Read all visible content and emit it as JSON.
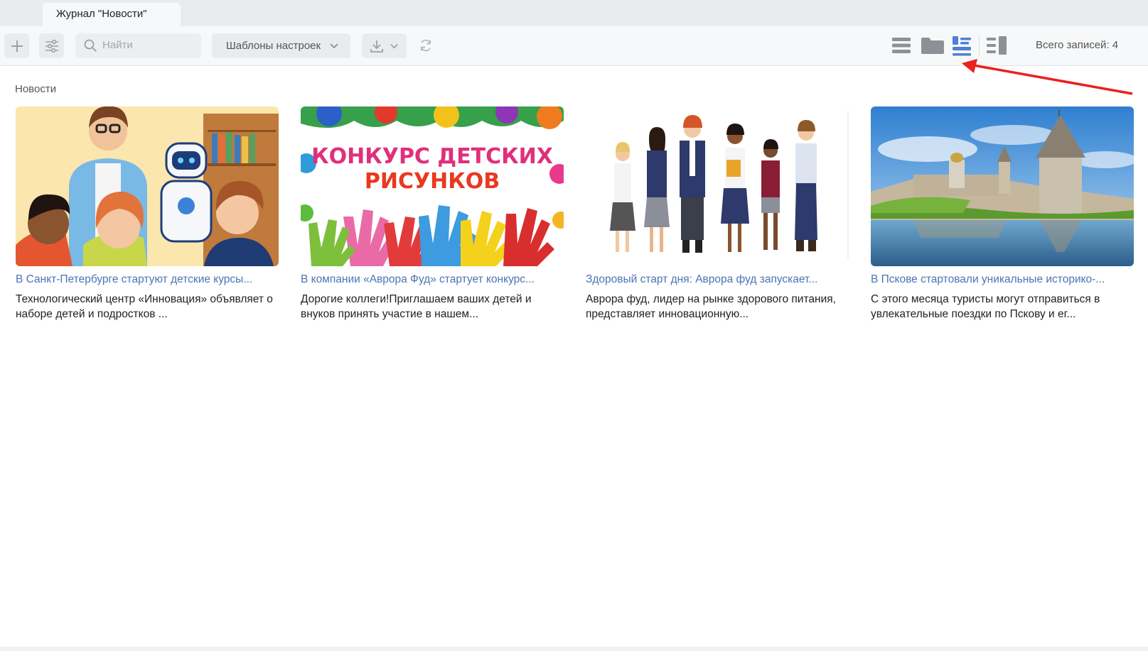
{
  "tab": {
    "label": "Журнал \"Новости\""
  },
  "toolbar": {
    "search_placeholder": "Найти",
    "templates_label": "Шаблоны настроек",
    "total_label": "Всего записей: 4",
    "icons": [
      "plus-icon",
      "filter-settings-icon",
      "search-icon",
      "chevron-down-icon",
      "download-icon",
      "refresh-icon",
      "list-view-icon",
      "folder-view-icon",
      "cards-view-icon",
      "split-view-icon"
    ],
    "active_view": "cards-view"
  },
  "group": {
    "title": "Новости"
  },
  "cards": [
    {
      "title": "В Санкт-Петербурге стартуют детские курсы...",
      "desc": "Технологический центр «Инновация» объявляет о наборе детей и подростков ...",
      "image": "teacher-kids-robot"
    },
    {
      "title": "В компании «Аврора Фуд» стартует конкурс...",
      "desc": "Дорогие коллеги!Приглашаем ваших детей и внуков принять участие в нашем...",
      "image": "drawing-contest"
    },
    {
      "title": "Здоровый старт дня: Аврора фуд запускает...",
      "desc": "Аврора фуд, лидер на рынке здорового питания, представляет инновационную...",
      "image": "schoolchildren"
    },
    {
      "title": "В Пскове стартовали уникальные историко-...",
      "desc": "С этого месяца туристы могут отправиться в увлекательные поездки по Пскову и ег...",
      "image": "pskov-kremlin"
    }
  ],
  "contest_image_text": [
    "КОНКУРС ДЕТСКИХ",
    "РИСУНКОВ"
  ],
  "colors": {
    "accent": "#4a74b5",
    "active_view_icon": "#4f7fd6",
    "annotation_arrow": "#e8221c"
  }
}
